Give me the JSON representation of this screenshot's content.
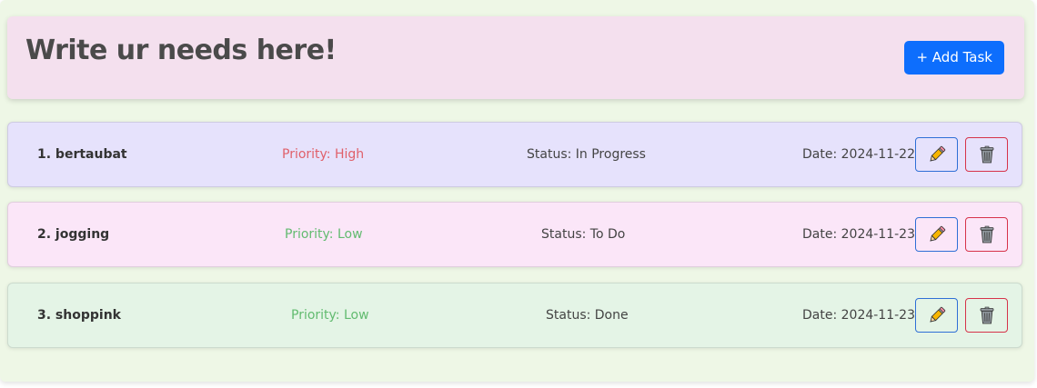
{
  "header": {
    "title": "Write ur needs here!",
    "add_label": "+ Add Task"
  },
  "tasks": [
    {
      "name": "1. bertaubat",
      "priority": "Priority: High",
      "status": "Status: In Progress",
      "date": "Date: 2024-11-22",
      "background": "#e6e2fc",
      "priority_color": "#e0606a"
    },
    {
      "name": "2. jogging",
      "priority": "Priority: Low",
      "status": "Status: To Do",
      "date": "Date: 2024-11-23",
      "background": "#fbe6f8",
      "priority_color": "#62bb70"
    },
    {
      "name": "3. shoppink",
      "priority": "Priority: Low",
      "status": "Status: Done",
      "date": "Date: 2024-11-23",
      "background": "#e4f4e6",
      "priority_color": "#62bb70"
    }
  ],
  "icons": {
    "edit": "pencil-icon",
    "delete": "trash-icon"
  },
  "colors": {
    "accent": "#0d6efd",
    "edit_border": "#2f6fd6",
    "delete_border": "#d6334a"
  }
}
